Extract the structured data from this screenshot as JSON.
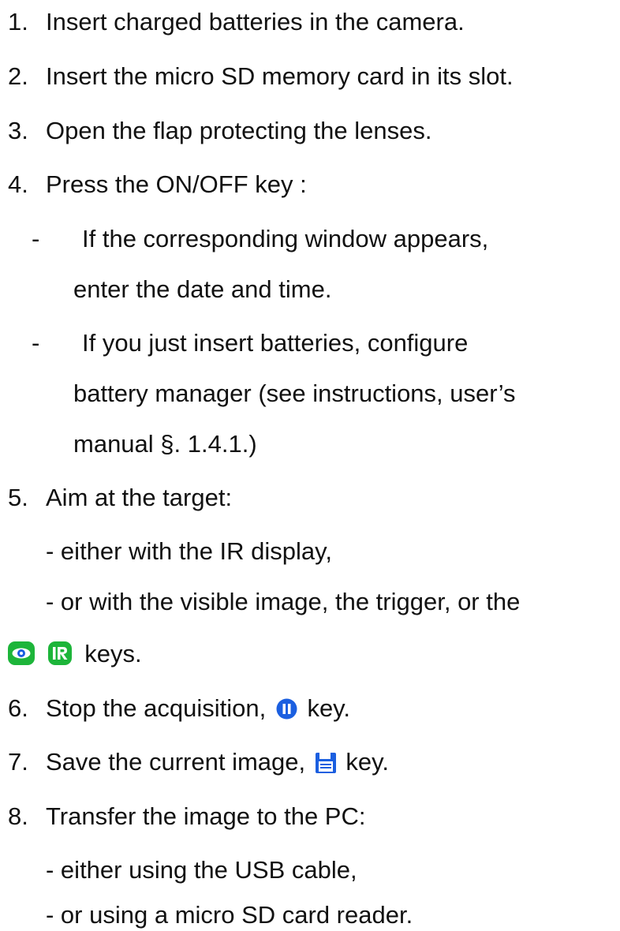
{
  "steps": [
    {
      "num": "1.",
      "text": "Insert charged batteries in the camera."
    },
    {
      "num": "2.",
      "text": "Insert the micro SD memory card in its slot."
    },
    {
      "num": "3.",
      "text": "Open the flap protecting the lenses."
    },
    {
      "num": "4.",
      "text": "Press the ON/OFF key :"
    },
    {
      "sub1_dash": "-",
      "sub1_a": "If the corresponding window appears,",
      "sub1_b": "enter the date and time.",
      "sub2_dash": "-",
      "sub2_a": "If you just insert batteries, configure",
      "sub2_b": "battery manager (see instructions, user’s",
      "sub2_c": "manual §. 1.4.1.)"
    },
    {
      "num": "5.",
      "text": "Aim at the target:",
      "sub_a": "- either with the IR display,",
      "sub_b": "- or with the visible image, the trigger, or the",
      "sub_c": "keys."
    },
    {
      "num": "6.",
      "text_before": "Stop the acquisition,",
      "text_after": "key."
    },
    {
      "num": "7.",
      "text_before": "Save the current image,",
      "text_after": "key."
    },
    {
      "num": "8.",
      "text": "Transfer the image to the PC:",
      "sub_a": "- either using the USB cable,",
      "sub_b": "- or using a micro SD card reader."
    }
  ],
  "icons": {
    "visible": "eye-icon",
    "ir": "ir-icon",
    "pause": "pause-icon",
    "save": "save-icon"
  },
  "colors": {
    "text": "#111111",
    "green": "#1db53a",
    "blue": "#1b5fe0"
  }
}
